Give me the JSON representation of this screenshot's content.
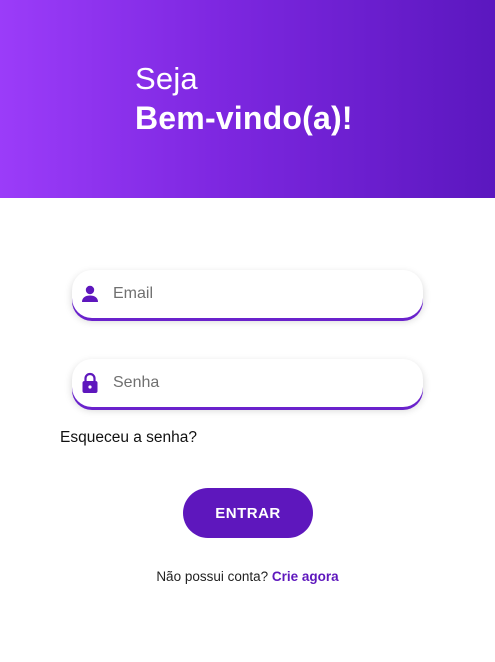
{
  "hero": {
    "greeting": "Seja",
    "welcome": "Bem-vindo(a)!"
  },
  "form": {
    "email": {
      "placeholder": "Email",
      "value": "",
      "icon": "user-icon"
    },
    "password": {
      "placeholder": "Senha",
      "value": "",
      "icon": "lock-icon"
    },
    "forgot_password": "Esqueceu a senha?",
    "submit_label": "ENTRAR"
  },
  "signup": {
    "prompt": "Não possui conta?",
    "link": "Crie agora"
  },
  "colors": {
    "brand_primary": "#5e17bd",
    "gradient_start": "#9b3cf9",
    "gradient_end": "#5b17bf"
  }
}
